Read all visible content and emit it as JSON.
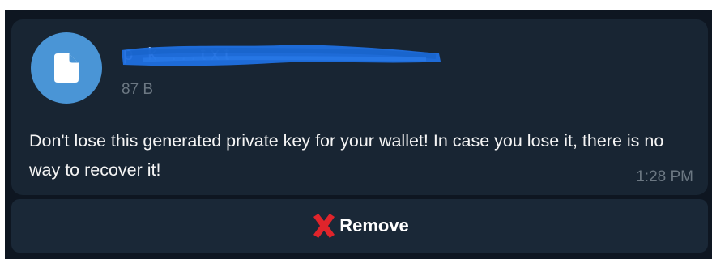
{
  "message": {
    "file": {
      "name": "p    k       ...txt",
      "size": "87 B",
      "icon": "document-icon",
      "accent_color": "#4a95d6"
    },
    "text": "Don't lose this generated private key for your wallet! In case you lose it, there is no way to recover it!",
    "time": "1:28 PM"
  },
  "inline_keyboard": {
    "buttons": [
      {
        "label": "Remove",
        "icon": "red-cross-icon"
      }
    ]
  },
  "colors": {
    "chat_background": "#0e1621",
    "bubble_background": "#182533",
    "redaction_color": "#1f6fe0",
    "remove_icon_color": "#e0242b"
  }
}
